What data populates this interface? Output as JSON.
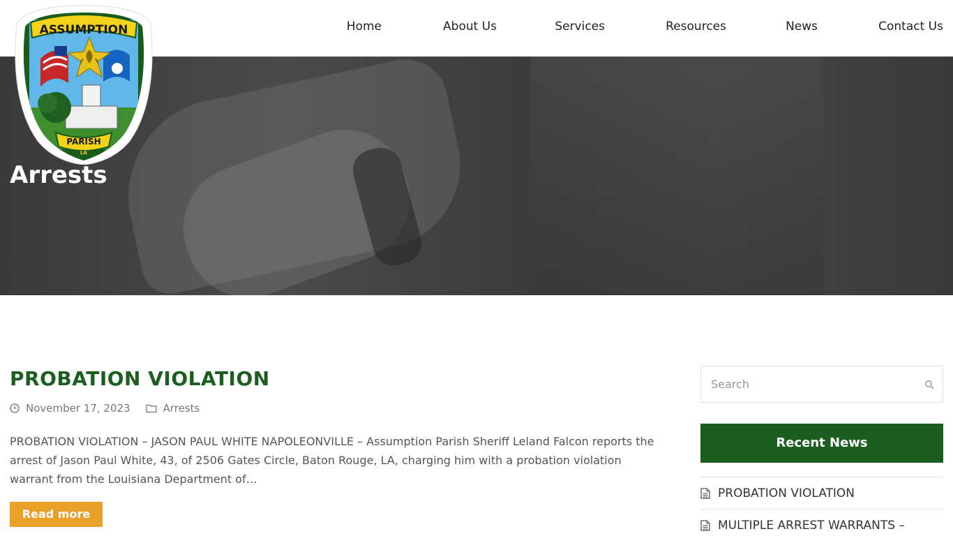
{
  "logo": {
    "top_text": "ASSUMPTION",
    "bottom_text": "PARISH",
    "state_text": "LA"
  },
  "nav": {
    "items": [
      "Home",
      "About Us",
      "Services",
      "Resources",
      "News",
      "Contact Us"
    ]
  },
  "hero": {
    "title": "Arrests"
  },
  "post": {
    "title": "PROBATION VIOLATION",
    "date": "November 17, 2023",
    "category": "Arrests",
    "excerpt": "PROBATION VIOLATION – JASON PAUL WHITE NAPOLEONVILLE – Assumption Parish Sheriff Leland Falcon reports the arrest of Jason Paul White, 43, of 2506 Gates Circle, Baton Rouge, LA, charging him with a probation violation warrant from the Louisiana Department of…",
    "read_more_label": "Read more"
  },
  "sidebar": {
    "search_placeholder": "Search",
    "recent_heading": "Recent News",
    "recent_items": [
      "PROBATION VIOLATION",
      "MULTIPLE ARREST WARRANTS –"
    ]
  },
  "colors": {
    "brand_green": "#1b5e20",
    "read_more_orange": "#e8a028",
    "hero_dark": "#3a3a3a"
  }
}
